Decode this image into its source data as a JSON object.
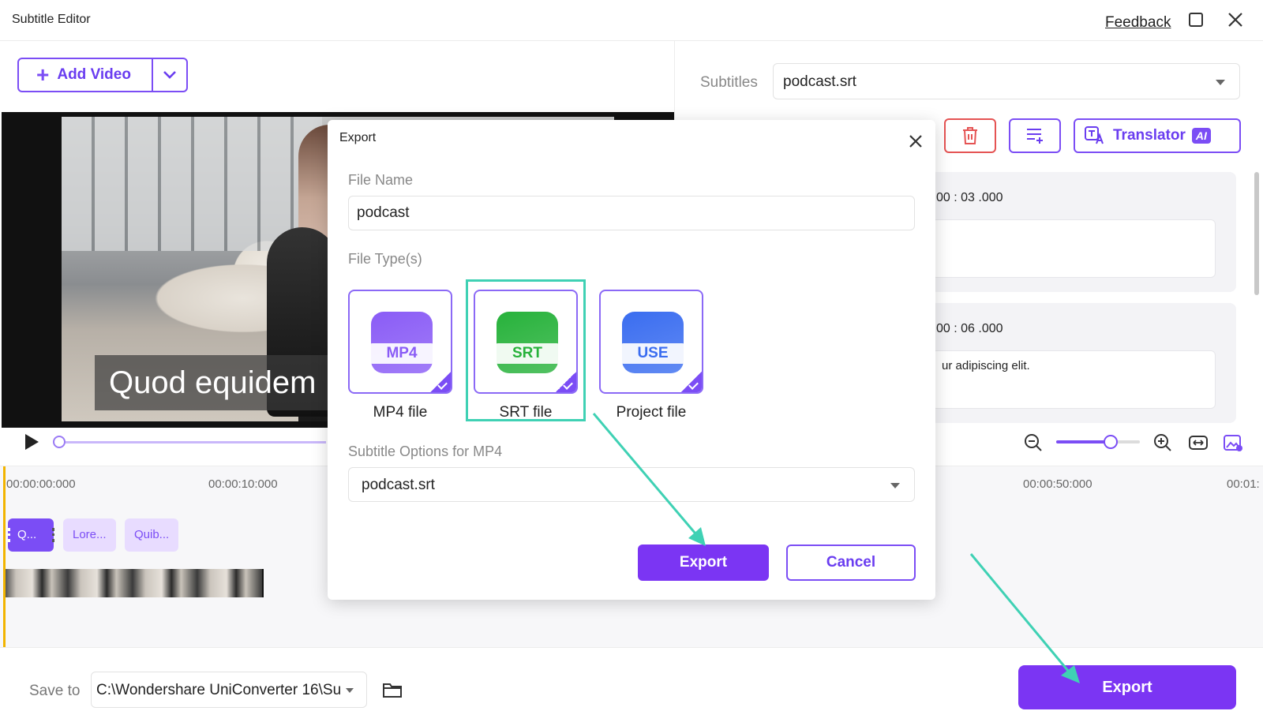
{
  "window": {
    "title": "Subtitle Editor",
    "feedback_label": "Feedback"
  },
  "toolbar": {
    "add_video_label": "Add Video"
  },
  "video": {
    "caption": "Quod equidem"
  },
  "timeline": {
    "ruler": [
      "00:00:00:000",
      "00:00:10:000",
      "00:00:50:000",
      "00:01:"
    ],
    "clips": [
      "Q...",
      "Lore...",
      "Quib..."
    ]
  },
  "bottom": {
    "save_label": "Save to",
    "save_path": "C:\\Wondershare UniConverter 16\\Su",
    "export_label": "Export"
  },
  "right_panel": {
    "subtitles_label": "Subtitles",
    "subtitles_value": "podcast.srt",
    "translator_label": "Translator",
    "ai_badge": "AI",
    "cards": [
      {
        "time": "00 : 03 .000",
        "text": ""
      },
      {
        "time": "00 : 06 .000",
        "text": "ur adipiscing elit."
      }
    ]
  },
  "modal": {
    "title": "Export",
    "file_name_label": "File Name",
    "file_name_value": "podcast",
    "file_types_label": "File Type(s)",
    "file_types": [
      {
        "tag": "MP4",
        "label": "MP4 file",
        "color": "#8a5cf6"
      },
      {
        "tag": "SRT",
        "label": "SRT file",
        "color": "#27b23b"
      },
      {
        "tag": "USE",
        "label": "Project file",
        "color": "#3a6df0"
      }
    ],
    "selected_type": "SRT file",
    "subtitle_options_label": "Subtitle Options for MP4",
    "subtitle_options_value": "podcast.srt",
    "export_label": "Export",
    "cancel_label": "Cancel"
  },
  "colors": {
    "accent": "#7b35f3",
    "annotation": "#3fd1b4",
    "danger": "#e55353"
  },
  "zoom": {
    "level": 0.65
  }
}
